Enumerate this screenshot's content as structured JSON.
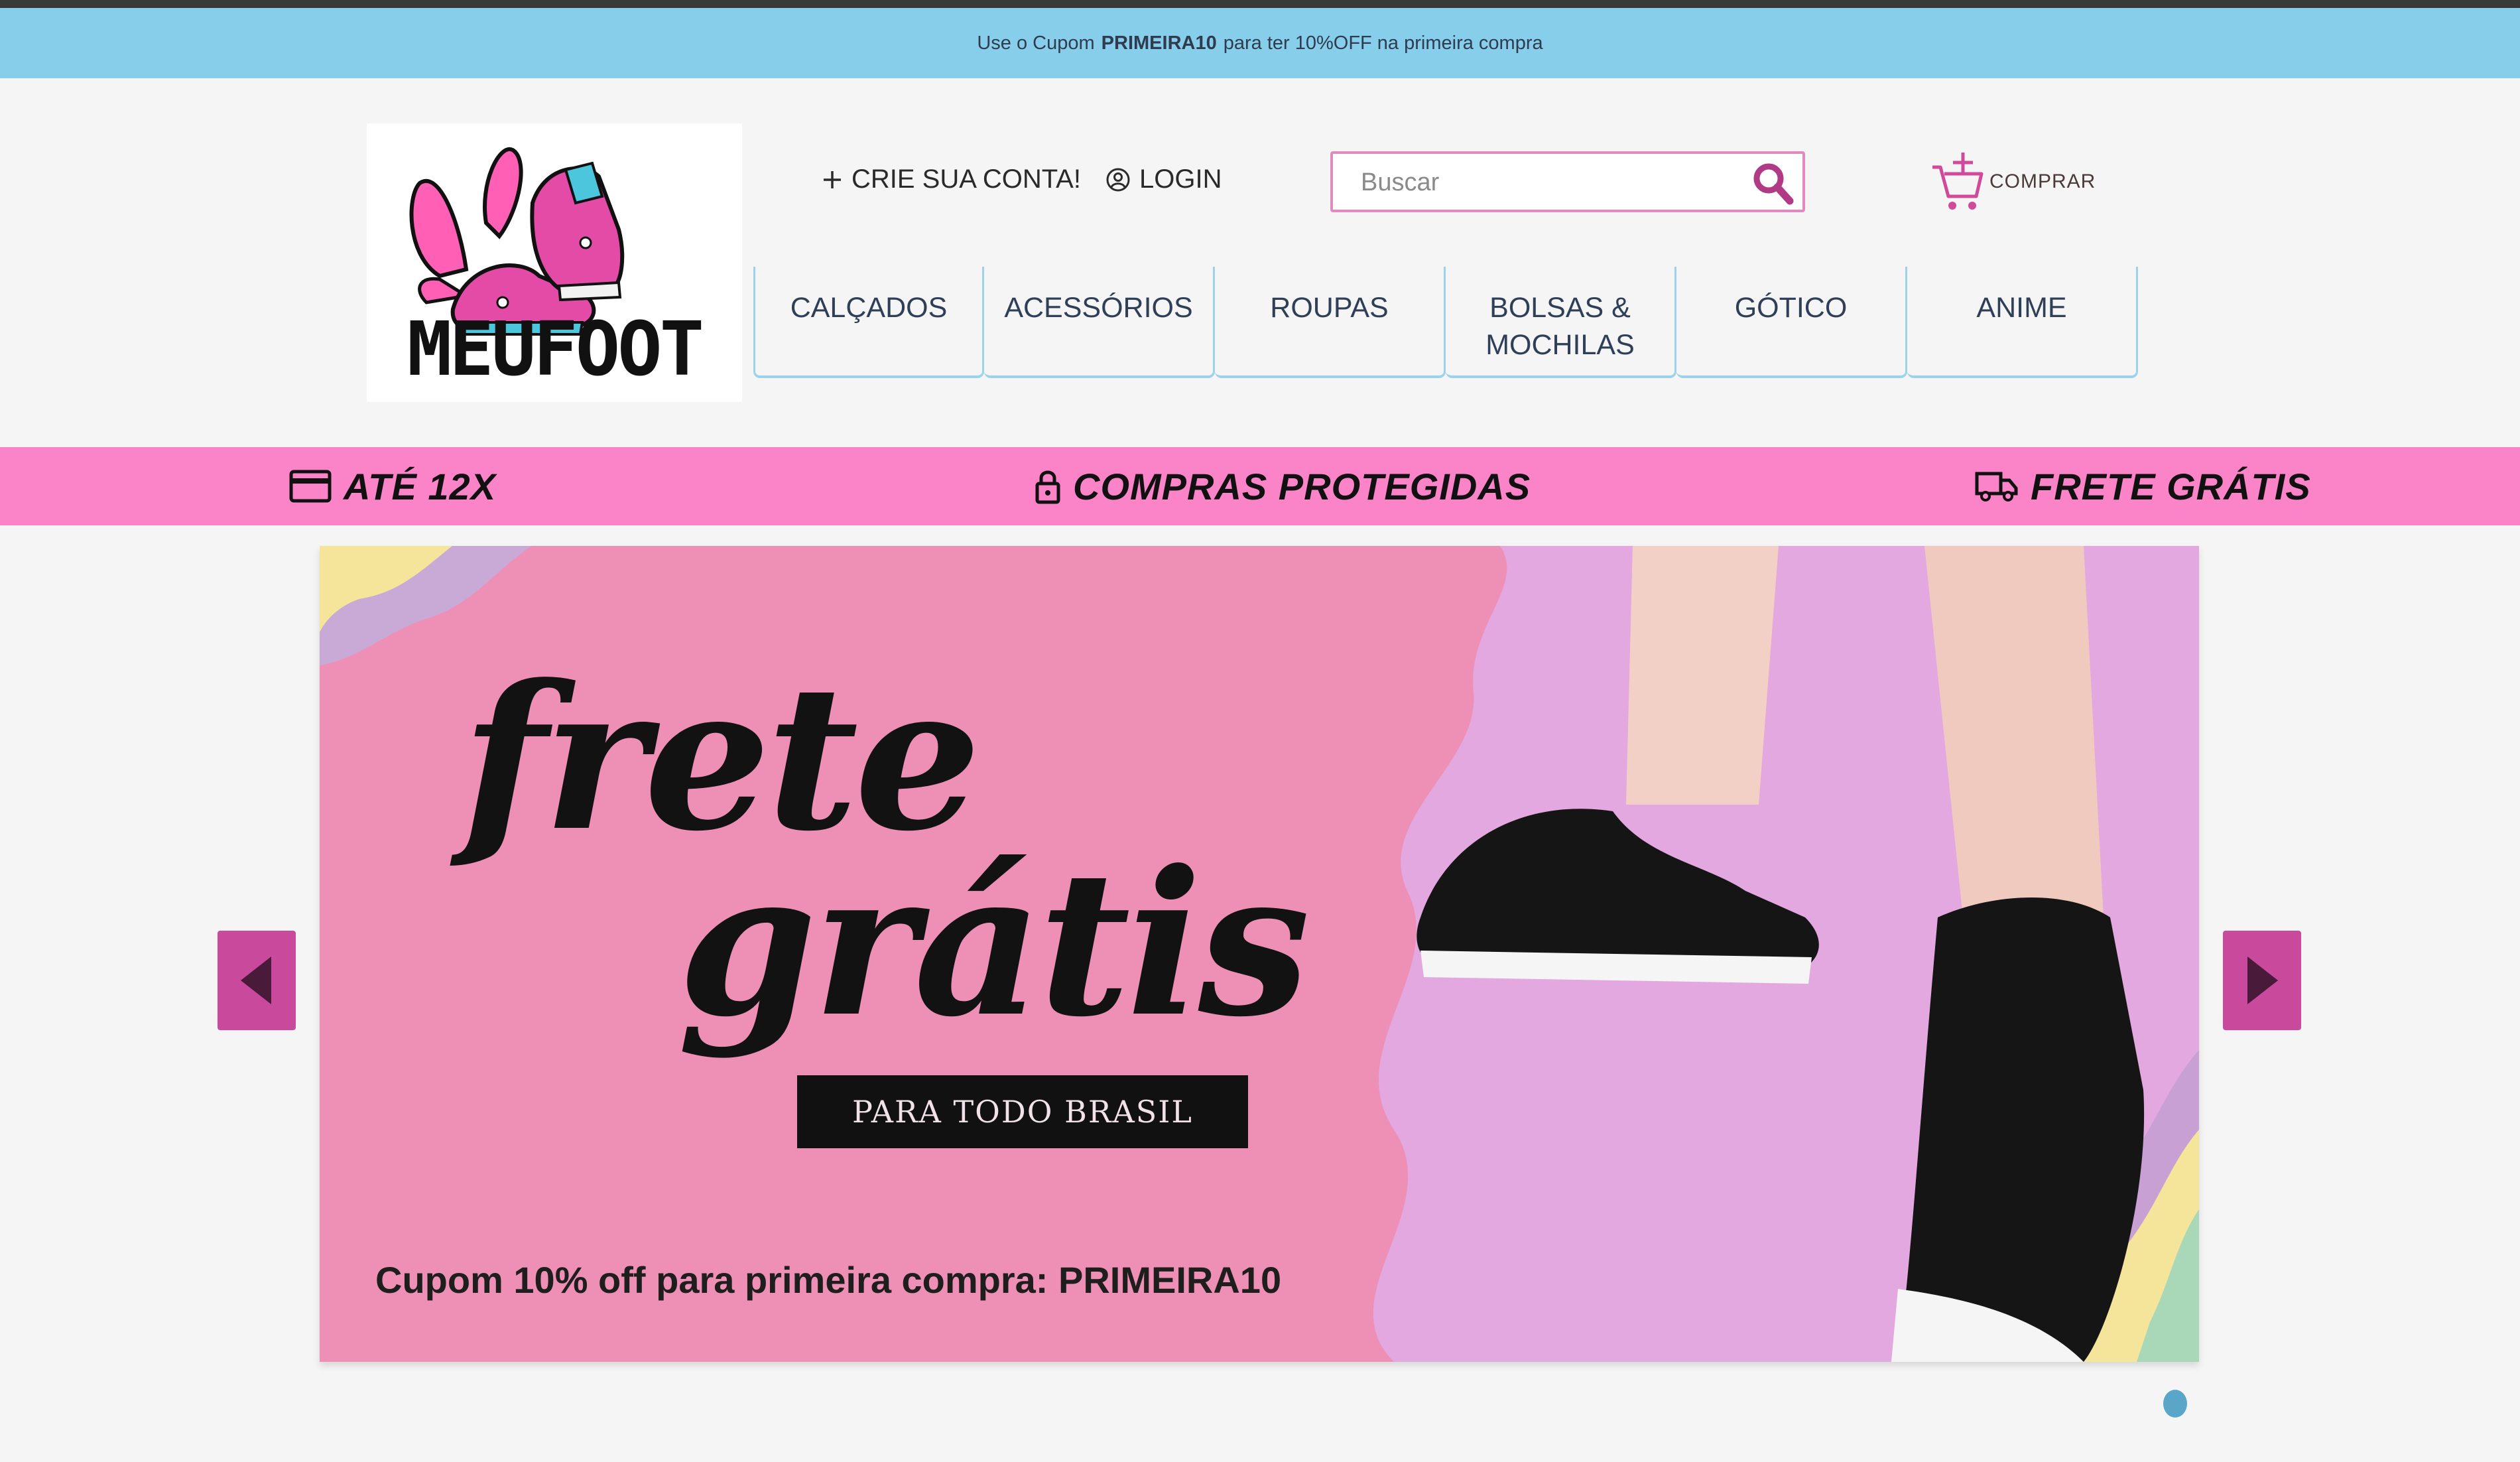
{
  "coupon_bar": {
    "prefix": "Use o Cupom",
    "code": "PRIMEIRA10",
    "suffix": "para ter 10%OFF na primeira compra"
  },
  "logo": {
    "text": "MEUFOOT"
  },
  "account": {
    "create_label": "CRIE SUA CONTA!",
    "login_label": "LOGIN"
  },
  "search": {
    "placeholder": "Buscar",
    "value": ""
  },
  "cart": {
    "label": "COMPRAR"
  },
  "nav": {
    "items": [
      {
        "label": "CALÇADOS"
      },
      {
        "label": "ACESSÓRIOS"
      },
      {
        "label": "ROUPAS"
      },
      {
        "label": "BOLSAS & MOCHILAS"
      },
      {
        "label": "GÓTICO"
      },
      {
        "label": "ANIME"
      }
    ]
  },
  "benefits": {
    "installments": "ATÉ 12X",
    "protected": "COMPRAS PROTEGIDAS",
    "shipping": "FRETE GRÁTIS"
  },
  "banner": {
    "title_line1": "frete",
    "title_line2": "grátis",
    "tag": "PARA TODO BRASIL",
    "coupon_text": "Cupom 10% off para primeira compra: PRIMEIRA10"
  },
  "carousel": {
    "current_slide": 1,
    "total_slides": 1
  },
  "colors": {
    "coupon_bar": "#87ceeb",
    "benefits_bar": "#fb84c9",
    "accent_pink": "#c94a9c",
    "nav_border": "#9cd3ea",
    "banner_bg": "#ee90b6",
    "dot": "#5aa6c8"
  },
  "icons": {
    "create_account": "plus-icon",
    "login": "user-circle-icon",
    "search": "search-icon",
    "cart": "cart-add-icon",
    "installments": "credit-card-icon",
    "protected": "lock-icon",
    "shipping": "truck-icon",
    "prev": "triangle-left-icon",
    "next": "triangle-right-icon"
  }
}
